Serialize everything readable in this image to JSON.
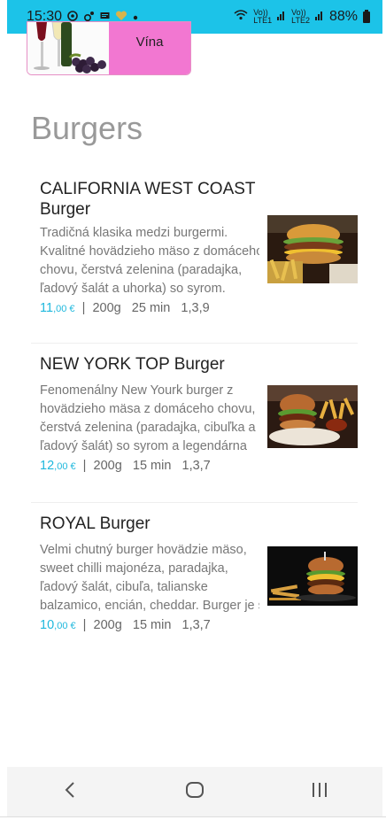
{
  "status_bar": {
    "time": "15:30",
    "notification_icons": [
      "whatsapp-icon",
      "settings-icon",
      "message-icon",
      "heart-icon",
      "dot-icon"
    ],
    "network_1": [
      "Vo))",
      "LTE1"
    ],
    "network_2": [
      "Vo))",
      "LTE2"
    ],
    "battery": "88%"
  },
  "category_card": {
    "label": "Vína",
    "accent": "#f277d1"
  },
  "section": {
    "title": "Burgers"
  },
  "items": [
    {
      "name_lines": [
        "CALIFORNIA WEST COAST",
        "Burger"
      ],
      "desc_lines": [
        "Tradičná klasika medzi burgermi.",
        "Kvalitné hovädzieho mäso z domáceho",
        "chovu, čerstvá zelenina (paradajka,",
        "ľadový šalát a uhorka) so syrom."
      ],
      "price_main": "11",
      "price_cents": ",00 €",
      "weight": "200g",
      "time": "25 min",
      "allergens": "1,3,9"
    },
    {
      "name_lines": [
        "NEW YORK TOP Burger"
      ],
      "desc_lines": [
        "Fenomenálny New Yourk burger z",
        "hovädzieho mäsa z domáceho chovu,",
        "čerstvá zelenina (paradajka, cibuľka a",
        "ľadový šalát) so syrom a legendárna"
      ],
      "price_main": "12",
      "price_cents": ",00 €",
      "weight": "200g",
      "time": "15 min",
      "allergens": "1,3,7"
    },
    {
      "name_lines": [
        "ROYAL Burger"
      ],
      "desc_lines": [
        "Velmi chutný burger hovädzie mäso,",
        "sweet chilli majonéza, paradajka,",
        "ľadový šalát, cibuľa, talianske",
        "balzamico, encián, cheddar. Burger je s"
      ],
      "price_main": "10",
      "price_cents": ",00 €",
      "weight": "200g",
      "time": "15 min",
      "allergens": "1,3,7"
    }
  ],
  "meta_separator": "|",
  "nav": {
    "back_icon": "back-chevron-icon",
    "home_icon": "home-icon",
    "recents_icon": "recents-icon"
  }
}
